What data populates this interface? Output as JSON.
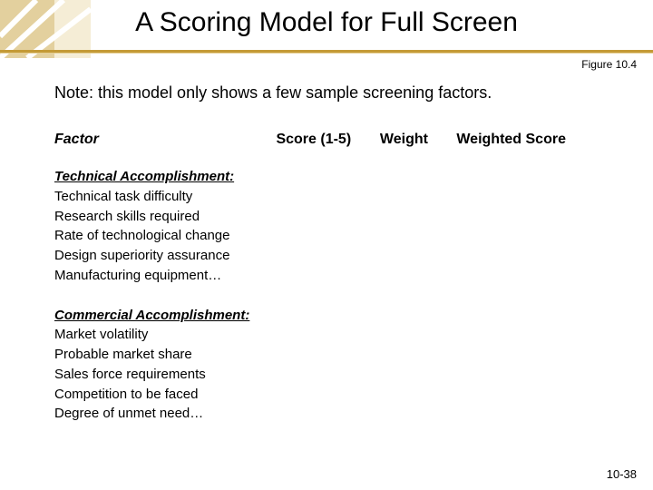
{
  "title": "A Scoring Model for Full Screen",
  "figure_ref": "Figure 10.4",
  "note": "Note: this model only shows a few sample screening factors.",
  "headers": {
    "factor": "Factor",
    "score": "Score (1-5)",
    "weight": "Weight",
    "wscore": "Weighted Score"
  },
  "groups": [
    {
      "heading": "Technical Accomplishment:",
      "items": [
        "Technical task difficulty",
        "Research skills required",
        "Rate of technological change",
        "Design superiority assurance",
        "Manufacturing equipment…"
      ]
    },
    {
      "heading": "Commercial Accomplishment:",
      "items": [
        "Market volatility",
        "Probable market share",
        "Sales force requirements",
        "Competition to be faced",
        "Degree of unmet need…"
      ]
    }
  ],
  "page_number": "10-38"
}
